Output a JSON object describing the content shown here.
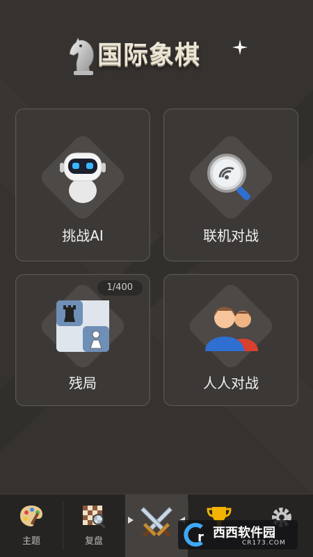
{
  "header": {
    "title": "国际象棋"
  },
  "menu": {
    "challenge_ai": {
      "label": "挑战AI"
    },
    "online_battle": {
      "label": "联机对战"
    },
    "endgame": {
      "label": "残局",
      "progress_text": "1/400"
    },
    "pvp": {
      "label": "人人对战"
    }
  },
  "tabs": [
    {
      "label": "主题",
      "icon": "palette-icon"
    },
    {
      "label": "复盘",
      "icon": "board-magnifier-icon"
    },
    {
      "label": "",
      "icon": "crossed-swords-icon",
      "active": true
    },
    {
      "label": "",
      "icon": "trophy-icon"
    },
    {
      "label": "",
      "icon": "gear-icon"
    }
  ],
  "watermark": {
    "text": "西西软件园",
    "sub": "CR173.COM"
  }
}
